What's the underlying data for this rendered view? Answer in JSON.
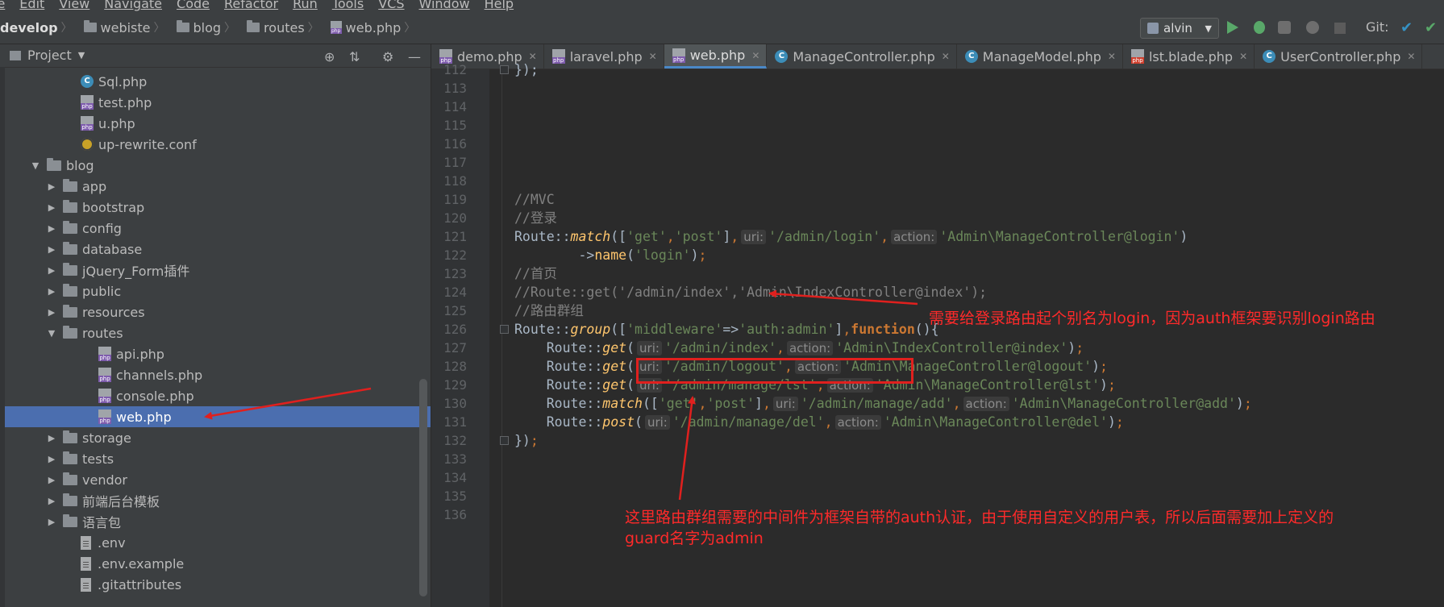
{
  "menu": [
    "le",
    "Edit",
    "View",
    "Navigate",
    "Code",
    "Refactor",
    "Run",
    "Tools",
    "VCS",
    "Window",
    "Help"
  ],
  "breadcrumb": [
    "develop",
    "webiste",
    "blog",
    "routes",
    "web.php"
  ],
  "run_config": "alvin",
  "git_label": "Git:",
  "project": {
    "title": "Project",
    "tree": [
      {
        "label": "Sql.php",
        "icon": "class",
        "level": 3
      },
      {
        "label": "test.php",
        "icon": "php",
        "level": 3
      },
      {
        "label": "u.php",
        "icon": "php",
        "level": 3
      },
      {
        "label": "up-rewrite.conf",
        "icon": "gear",
        "level": 3
      },
      {
        "label": "blog",
        "icon": "folder",
        "level": 1,
        "expanded": true
      },
      {
        "label": "app",
        "icon": "folder",
        "level": 2
      },
      {
        "label": "bootstrap",
        "icon": "folder",
        "level": 2
      },
      {
        "label": "config",
        "icon": "folder",
        "level": 2
      },
      {
        "label": "database",
        "icon": "folder",
        "level": 2
      },
      {
        "label": "jQuery_Form插件",
        "icon": "folder",
        "level": 2
      },
      {
        "label": "public",
        "icon": "folder",
        "level": 2
      },
      {
        "label": "resources",
        "icon": "folder",
        "level": 2
      },
      {
        "label": "routes",
        "icon": "folder",
        "level": 2,
        "expanded": true
      },
      {
        "label": "api.php",
        "icon": "php",
        "level": 4
      },
      {
        "label": "channels.php",
        "icon": "php",
        "level": 4
      },
      {
        "label": "console.php",
        "icon": "php",
        "level": 4
      },
      {
        "label": "web.php",
        "icon": "php",
        "level": 4,
        "selected": true
      },
      {
        "label": "storage",
        "icon": "folder",
        "level": 2
      },
      {
        "label": "tests",
        "icon": "folder",
        "level": 2
      },
      {
        "label": "vendor",
        "icon": "folder",
        "level": 2
      },
      {
        "label": "前端后台模板",
        "icon": "folder",
        "level": 2
      },
      {
        "label": "语言包",
        "icon": "folder",
        "level": 2
      },
      {
        "label": ".env",
        "icon": "file",
        "level": 3
      },
      {
        "label": ".env.example",
        "icon": "file",
        "level": 3
      },
      {
        "label": ".gitattributes",
        "icon": "file",
        "level": 3
      }
    ]
  },
  "tabs": [
    {
      "label": "demo.php",
      "icon": "php"
    },
    {
      "label": "laravel.php",
      "icon": "php"
    },
    {
      "label": "web.php",
      "icon": "php",
      "active": true
    },
    {
      "label": "ManageController.php",
      "icon": "class"
    },
    {
      "label": "ManageModel.php",
      "icon": "class"
    },
    {
      "label": "lst.blade.php",
      "icon": "blade"
    },
    {
      "label": "UserController.php",
      "icon": "class"
    }
  ],
  "code_lines": [
    {
      "n": "112",
      "html": "});"
    },
    {
      "n": "113",
      "html": ""
    },
    {
      "n": "114",
      "html": ""
    },
    {
      "n": "115",
      "html": ""
    },
    {
      "n": "116",
      "html": ""
    },
    {
      "n": "117",
      "html": ""
    },
    {
      "n": "118",
      "html": ""
    },
    {
      "n": "119",
      "html": "<span class='c-comment'>//MVC</span>"
    },
    {
      "n": "120",
      "html": "<span class='c-comment'>//登录</span>"
    },
    {
      "n": "121",
      "html": "Route::<span class='c-fn'>match</span>([<span class='c-str'>'get'</span><span class='c-punc'>,</span><span class='c-str'>'post'</span>]<span class='c-punc'>,</span><span class='hint'>uri:</span><span class='c-str'>'/admin/login'</span><span class='c-punc'>,</span><span class='hint'>action:</span><span class='c-str'>'Admin\\ManageController@login'</span>)"
    },
    {
      "n": "122",
      "html": "        -><span class='c-name'>name</span>(<span class='c-str'>'login'</span>)<span class='c-punc'>;</span>"
    },
    {
      "n": "123",
      "html": "<span class='c-comment'>//首页</span>"
    },
    {
      "n": "124",
      "html": "<span class='c-comment'>//Route::get('/admin/index','Admin\\IndexController@index');</span>"
    },
    {
      "n": "125",
      "html": "<span class='c-comment'>//路由群组</span>"
    },
    {
      "n": "126",
      "html": "Route::<span class='c-fn'>group</span>([<span class='c-str'>'middleware'</span>=><span class='c-str'>'auth:admin'</span>]<span class='c-punc'>,</span><span class='c-kw'>function</span>(){"
    },
    {
      "n": "127",
      "html": "    Route::<span class='c-fn'>get</span>(<span class='hint'>uri:</span><span class='c-str'>'/admin/index'</span><span class='c-punc'>,</span><span class='hint'>action:</span><span class='c-str'>'Admin\\IndexController@index'</span>)<span class='c-punc'>;</span>"
    },
    {
      "n": "128",
      "html": "    Route::<span class='c-fn'>get</span>(<span class='hint'>uri:</span><span class='c-str'>'/admin/logout'</span><span class='c-punc'>,</span><span class='hint'>action:</span><span class='c-str'>'Admin\\ManageController@logout'</span>)<span class='c-punc'>;</span>"
    },
    {
      "n": "129",
      "html": "    Route::<span class='c-fn'>get</span>(<span class='hint'>uri:</span><span class='c-str'>'/admin/manage/lst'</span><span class='c-punc'>,</span><span class='hint'>action:</span><span class='c-str'>'Admin\\ManageController@lst'</span>)<span class='c-punc'>;</span>"
    },
    {
      "n": "130",
      "html": "    Route::<span class='c-fn'>match</span>([<span class='c-str'>'get'</span><span class='c-punc'>,</span><span class='c-str'>'post'</span>]<span class='c-punc'>,</span><span class='hint'>uri:</span><span class='c-str'>'/admin/manage/add'</span><span class='c-punc'>,</span><span class='hint'>action:</span><span class='c-str'>'Admin\\ManageController@add'</span>)<span class='c-punc'>;</span>"
    },
    {
      "n": "131",
      "html": "    Route::<span class='c-fn'>post</span>(<span class='hint'>uri:</span><span class='c-str'>'/admin/manage/del'</span><span class='c-punc'>,</span><span class='hint'>action:</span><span class='c-str'>'Admin\\ManageController@del'</span>)<span class='c-punc'>;</span>"
    },
    {
      "n": "132",
      "html": "})<span class='c-punc'>;</span>"
    },
    {
      "n": "133",
      "html": ""
    },
    {
      "n": "134",
      "html": ""
    },
    {
      "n": "135",
      "html": ""
    },
    {
      "n": "136",
      "html": ""
    }
  ],
  "annotations": {
    "login_note": "需要给登录路由起个别名为login，因为auth框架要识别login路由",
    "middleware_note_1": "这里路由群组需要的中间件为框架自带的auth认证，由于使用自定义的用户表，所以后面需要加上定义的",
    "middleware_note_2": "guard名字为admin"
  },
  "colors": {
    "annotation": "#ff2a2a",
    "selection": "#4b6eaf",
    "tab_underline": "#4a88c7"
  }
}
